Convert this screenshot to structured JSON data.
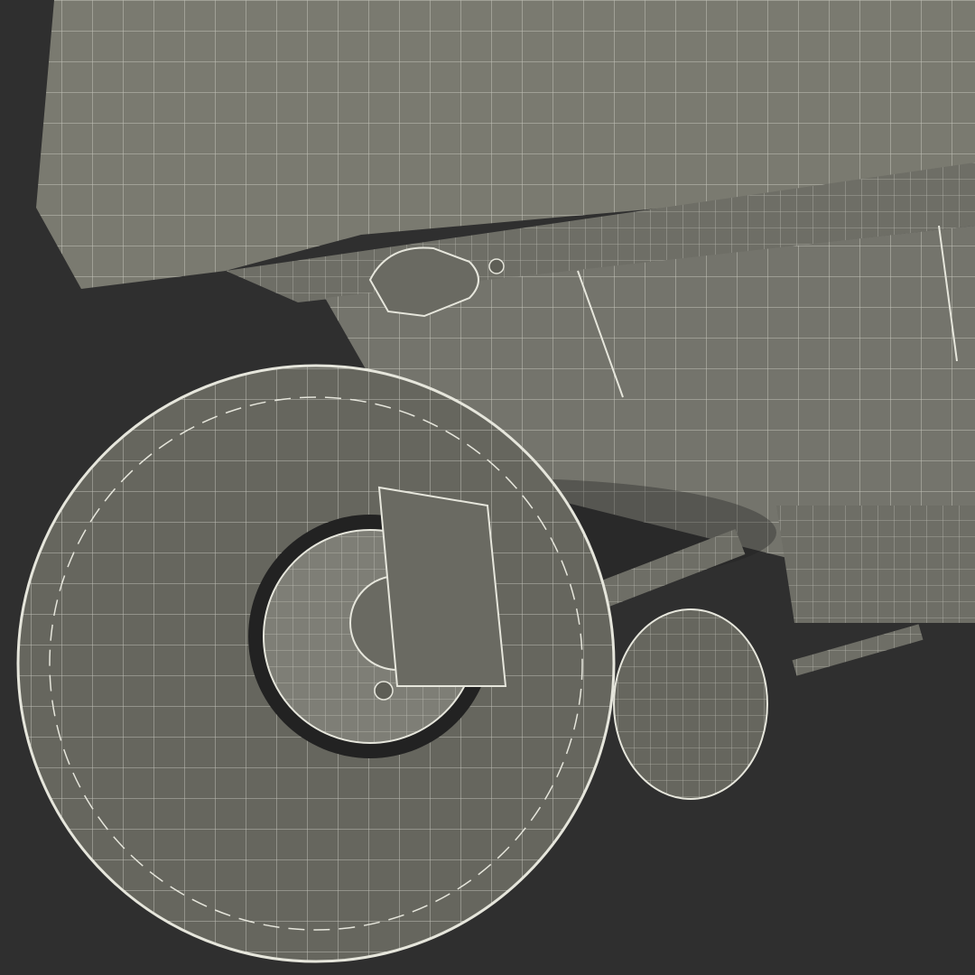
{
  "scene": {
    "subject": "wireframe-render",
    "colors": {
      "background": "#2f2f2f",
      "body_fill": "#7a7a70",
      "body_dark": "#5e5e56",
      "tire_fill": "#6a6a62",
      "rim_fill": "#7e7e76",
      "wire": "#e6e6dc",
      "shadow": "#1f1f1f"
    }
  }
}
